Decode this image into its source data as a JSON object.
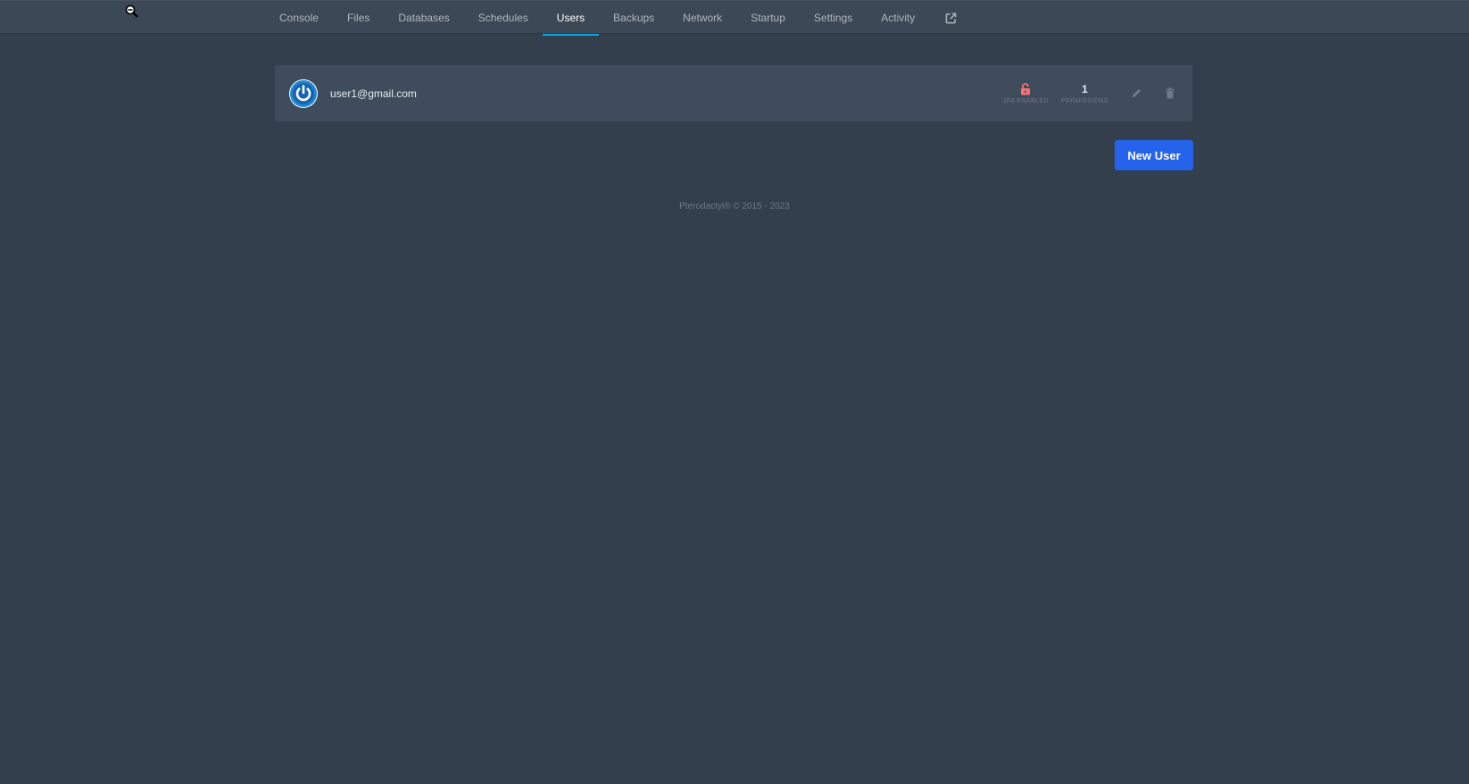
{
  "nav": {
    "items": [
      {
        "label": "Console"
      },
      {
        "label": "Files"
      },
      {
        "label": "Databases"
      },
      {
        "label": "Schedules"
      },
      {
        "label": "Users"
      },
      {
        "label": "Backups"
      },
      {
        "label": "Network"
      },
      {
        "label": "Startup"
      },
      {
        "label": "Settings"
      },
      {
        "label": "Activity"
      }
    ],
    "active": "Users",
    "external_icon": "external-link-icon"
  },
  "users": [
    {
      "email": "user1@gmail.com",
      "avatar_icon": "power-icon",
      "twofa_label": "2FA Enabled",
      "twofa_icon": "unlock-icon",
      "permissions_count": "1",
      "permissions_label": "Permissions"
    }
  ],
  "new_user_label": "New User",
  "footer": "Pterodactyl® © 2015 - 2023",
  "colors": {
    "accent": "#2563eb",
    "active_tab": "#0ea5e9",
    "twofa_disabled": "#f87171",
    "avatar_blue": "#1e88d6"
  }
}
